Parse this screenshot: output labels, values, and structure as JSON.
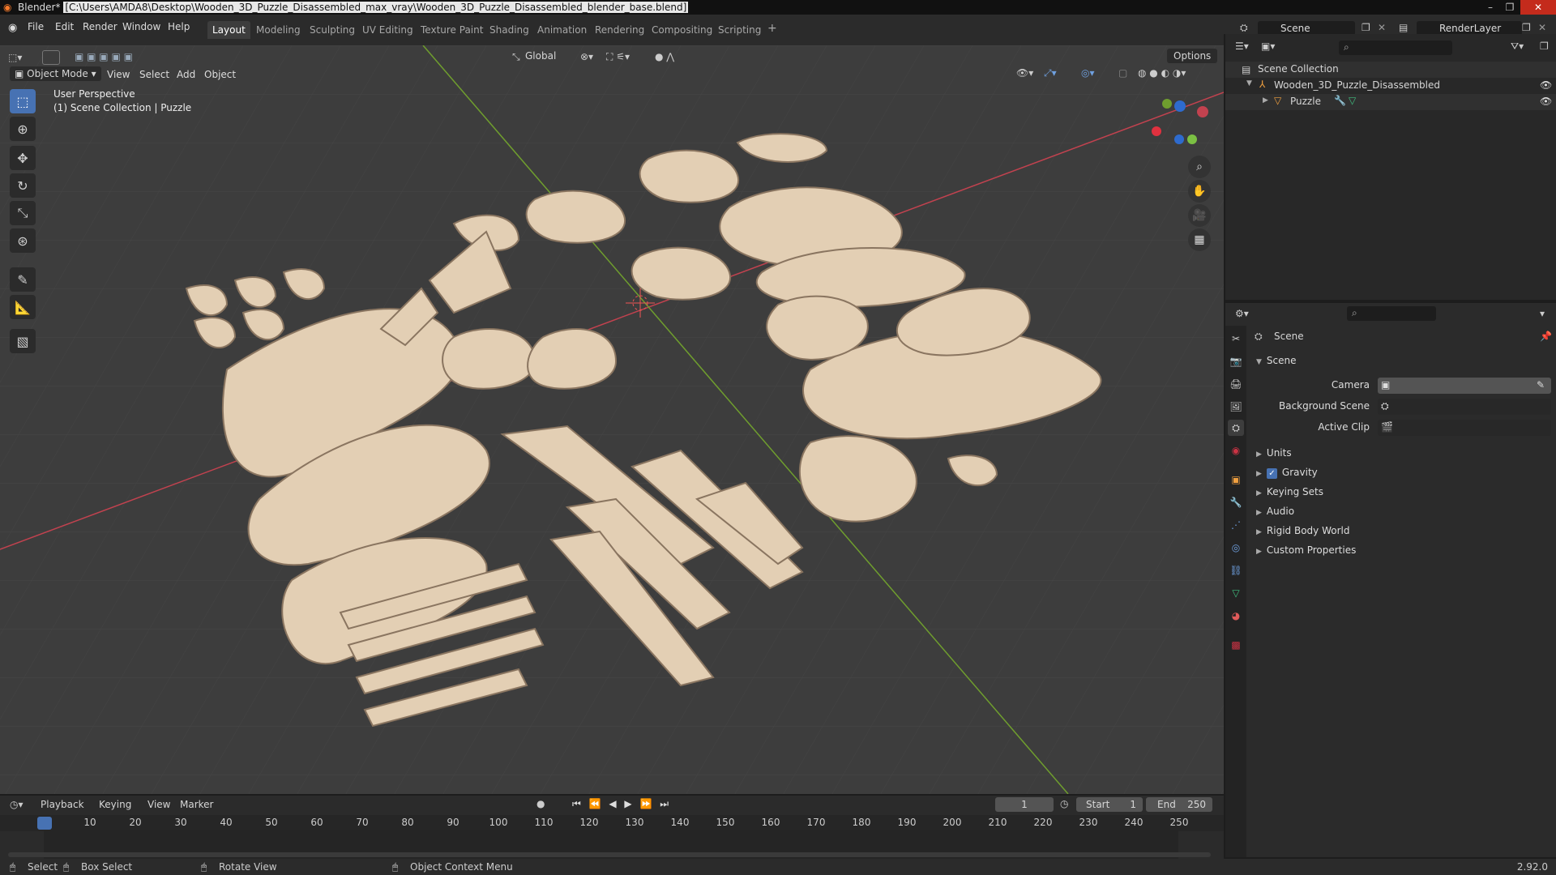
{
  "title_bar": {
    "app": "Blender*",
    "path": "[C:\\Users\\AMDA8\\Desktop\\Wooden_3D_Puzzle_Disassembled_max_vray\\Wooden_3D_Puzzle_Disassembled_blender_base.blend]"
  },
  "menu": [
    "File",
    "Edit",
    "Render",
    "Window",
    "Help"
  ],
  "workspaces": [
    "Layout",
    "Modeling",
    "Sculpting",
    "UV Editing",
    "Texture Paint",
    "Shading",
    "Animation",
    "Rendering",
    "Compositing",
    "Scripting"
  ],
  "active_workspace": "Layout",
  "scene_field": "Scene",
  "renderlayer_field": "RenderLayer",
  "viewport": {
    "mode": "Object Mode",
    "header_menus": [
      "View",
      "Select",
      "Add",
      "Object"
    ],
    "transform_orientation": "Global",
    "options_label": "Options",
    "overlay_title": "User Perspective",
    "overlay_subtitle": "(1) Scene Collection | Puzzle"
  },
  "outliner": {
    "root": "Scene Collection",
    "items": [
      {
        "label": "Wooden_3D_Puzzle_Disassembled"
      },
      {
        "label": "Puzzle"
      }
    ]
  },
  "properties": {
    "header": "Scene",
    "panel": "Scene",
    "fields": [
      {
        "label": "Camera"
      },
      {
        "label": "Background Scene"
      },
      {
        "label": "Active Clip"
      }
    ],
    "sections": [
      "Units",
      "Gravity",
      "Keying Sets",
      "Audio",
      "Rigid Body World",
      "Custom Properties"
    ],
    "gravity_checked": true
  },
  "timeline": {
    "menus": [
      "Playback",
      "Keying",
      "View",
      "Marker"
    ],
    "current_frame": "1",
    "start_label": "Start",
    "start_value": "1",
    "end_label": "End",
    "end_value": "250",
    "ticks": [
      "1",
      "10",
      "20",
      "30",
      "40",
      "50",
      "60",
      "70",
      "80",
      "90",
      "100",
      "110",
      "120",
      "130",
      "140",
      "150",
      "160",
      "170",
      "180",
      "190",
      "200",
      "210",
      "220",
      "230",
      "240",
      "250"
    ]
  },
  "statusbar": {
    "select": "Select",
    "box_select": "Box Select",
    "rotate_view": "Rotate View",
    "context_menu": "Object Context Menu",
    "version": "2.92.0"
  },
  "colors": {
    "accent": "#4772b3",
    "wood": "#e3cfb4",
    "x_axis": "#c2424f",
    "y_axis": "#6f9e2e"
  }
}
